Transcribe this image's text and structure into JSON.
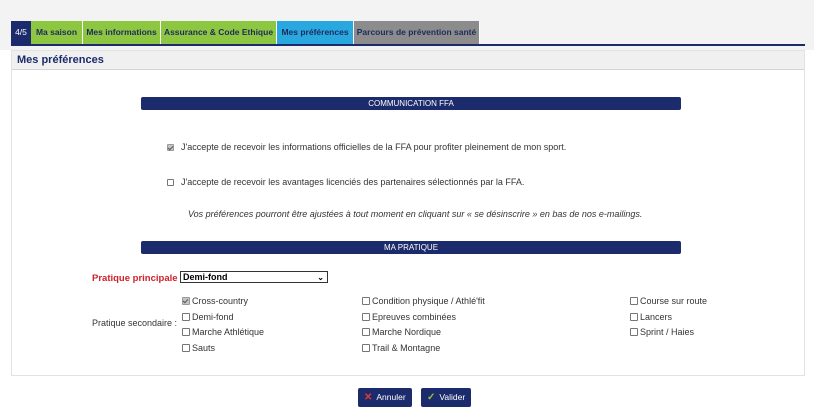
{
  "tabs": [
    {
      "label": "4/5",
      "style": "step"
    },
    {
      "label": "Ma saison",
      "style": "green"
    },
    {
      "label": "Mes informations",
      "style": "green"
    },
    {
      "label": "Assurance & Code Ethique",
      "style": "green"
    },
    {
      "label": "Mes préférences",
      "style": "blue"
    },
    {
      "label": "Parcours de prévention santé",
      "style": "grey"
    }
  ],
  "panel_title": "Mes préférences",
  "communication": {
    "header": "COMMUNICATION FFA",
    "option1": {
      "label": "J'accepte de recevoir les informations officielles de la FFA pour profiter pleinement de mon sport.",
      "checked": true
    },
    "option2": {
      "label": "J'accepte de recevoir les avantages licenciés des partenaires sélectionnés par la FFA.",
      "checked": false
    },
    "note": "Vos préférences pourront être ajustées à tout moment en cliquant sur « se désinscrire » en bas de nos e-mailings."
  },
  "pratique": {
    "header": "MA PRATIQUE",
    "principale_label": "Pratique principale :",
    "principale_value": "Demi-fond",
    "secondaire_label": "Pratique secondaire :",
    "disciplines": [
      {
        "label": "Cross-country",
        "checked": true
      },
      {
        "label": "Condition physique / Athlé'fit",
        "checked": false
      },
      {
        "label": "Course sur route",
        "checked": false
      },
      {
        "label": "Demi-fond",
        "checked": false
      },
      {
        "label": "Epreuves combinées",
        "checked": false
      },
      {
        "label": "Lancers",
        "checked": false
      },
      {
        "label": "Marche Athlétique",
        "checked": false
      },
      {
        "label": "Marche Nordique",
        "checked": false
      },
      {
        "label": "Sprint / Haies",
        "checked": false
      },
      {
        "label": "Sauts",
        "checked": false
      },
      {
        "label": "Trail & Montagne",
        "checked": false
      }
    ]
  },
  "buttons": {
    "cancel": {
      "label": "Annuler",
      "icon": "close-icon",
      "icon_color": "#e53935"
    },
    "validate": {
      "label": "Valider",
      "icon": "check-icon",
      "icon_color": "#8dc641"
    }
  },
  "colors": {
    "navy": "#1b2b6b",
    "green": "#8dc641",
    "blue": "#29a8e0",
    "grey": "#8c8c8c",
    "red": "#d0202a"
  }
}
